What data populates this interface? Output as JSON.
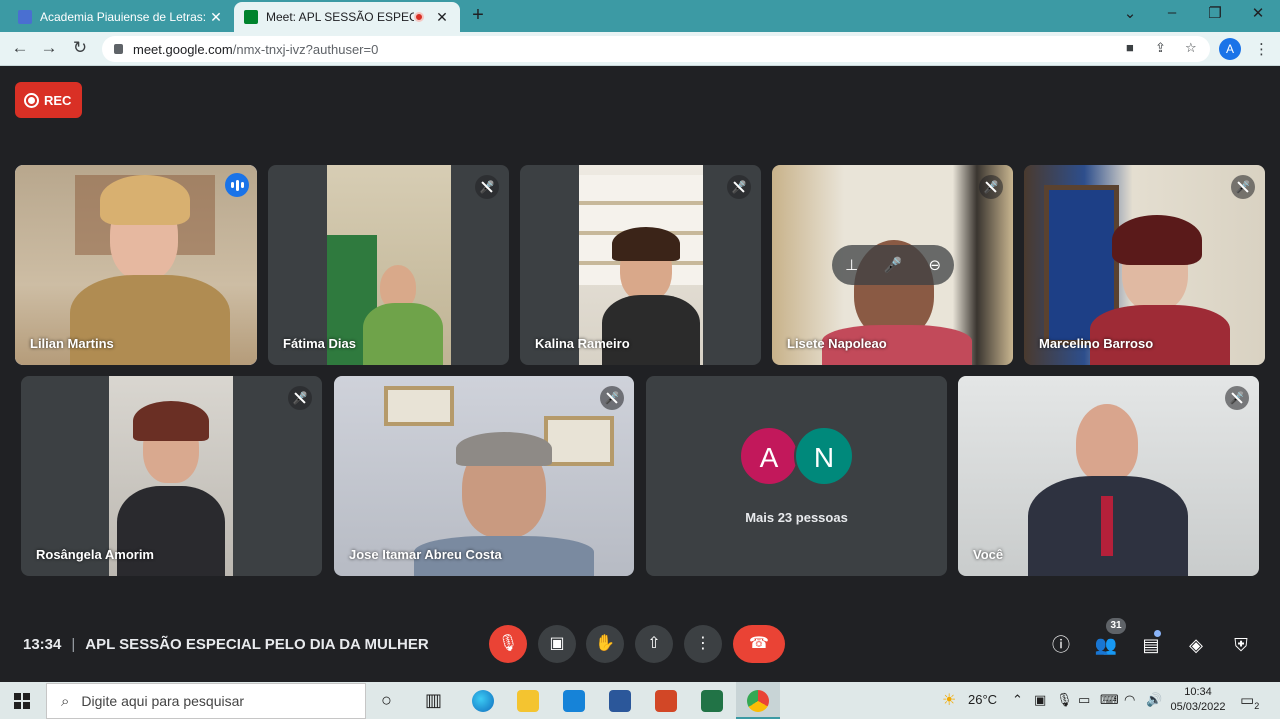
{
  "browser": {
    "tabs": [
      {
        "title": "Academia Piauiense de Letras: ag",
        "favicon_color": "#4a6fd1"
      },
      {
        "title": "Meet: APL SESSÃO ESPECIAL",
        "favicon_color": "#00832d",
        "recording": true
      }
    ],
    "url_host": "meet.google.com",
    "url_path": "/nmx-tnxj-ivz?authuser=0",
    "profile_initial": "A"
  },
  "meet": {
    "rec_label": "REC",
    "tiles": [
      {
        "name": "Lilian Martins",
        "speaking": true
      },
      {
        "name": "Fátima Dias"
      },
      {
        "name": "Kalina Rameiro"
      },
      {
        "name": "Lisete Napoleao"
      },
      {
        "name": "Marcelino Barroso"
      },
      {
        "name": "Rosângela Amorim"
      },
      {
        "name": "Jose Itamar Abreu Costa"
      },
      {
        "name": "Você"
      }
    ],
    "others": {
      "avatars": [
        {
          "initial": "A",
          "color": "#c2185b"
        },
        {
          "initial": "N",
          "color": "#00897b"
        }
      ],
      "label": "Mais 23 pessoas"
    },
    "bottom": {
      "time": "13:34",
      "separator": "|",
      "meeting_title": "APL SESSÃO ESPECIAL PELO DIA DA MULHER",
      "participants_count": "31"
    }
  },
  "taskbar": {
    "search_placeholder": "Digite aqui para pesquisar",
    "weather": "26°C",
    "time": "10:34",
    "date": "05/03/2022",
    "notifications": "2"
  },
  "colors": {
    "stage_bg": "#202124",
    "tile_bg": "#3c4043",
    "danger": "#ea4335",
    "accent": "#1a73e8",
    "tab_strip": "#3c9aa4"
  }
}
